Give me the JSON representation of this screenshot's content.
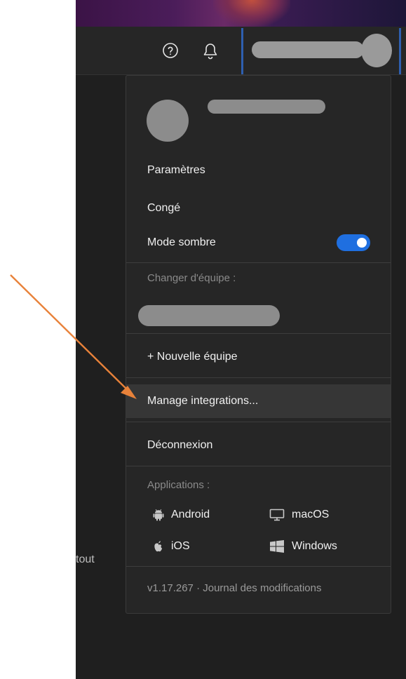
{
  "background": {
    "text": "tout"
  },
  "topbar": {
    "help_icon": "help-circle-icon",
    "bell_icon": "bell-icon"
  },
  "menu": {
    "settings_label": "Paramètres",
    "leave_label": "Congé",
    "dark_mode_label": "Mode sombre",
    "dark_mode_enabled": true,
    "switch_team_label": "Changer d'équipe :",
    "new_team_label": "+ Nouvelle équipe",
    "manage_integrations_label": "Manage integrations...",
    "logout_label": "Déconnexion",
    "applications_label": "Applications :",
    "apps": {
      "android": "Android",
      "macos": "macOS",
      "ios": "iOS",
      "windows": "Windows"
    },
    "version": "v1.17.267",
    "separator": "·",
    "changelog_label": "Journal des modifications"
  },
  "colors": {
    "accent": "#1f6fe0",
    "annotation_arrow": "#e8823a",
    "menu_bg": "#262626"
  }
}
